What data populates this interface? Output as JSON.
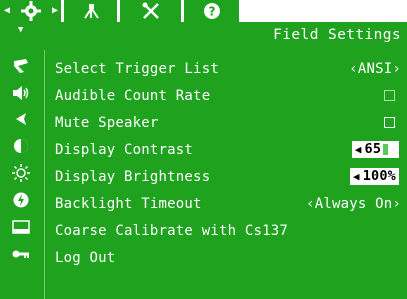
{
  "header": {
    "title": "Field Settings"
  },
  "tabs": [
    {
      "icon": "gear-icon"
    },
    {
      "icon": "tripod-icon"
    },
    {
      "icon": "tools-icon"
    },
    {
      "icon": "help-icon"
    }
  ],
  "menu": {
    "items": [
      {
        "label": "Select Trigger List",
        "value": "‹ANSI›",
        "icon": "flag-icon"
      },
      {
        "label": "Audible Count Rate",
        "icon": "speaker-icon"
      },
      {
        "label": "Mute Speaker",
        "icon": "mute-icon"
      },
      {
        "label": "Display Contrast",
        "value": "65",
        "icon": "contrast-icon"
      },
      {
        "label": "Display Brightness",
        "value": "100%",
        "icon": "brightness-icon"
      },
      {
        "label": "Backlight Timeout",
        "value": "‹Always On›",
        "icon": "backlight-icon"
      },
      {
        "label": "Coarse Calibrate with Cs137",
        "icon": "calibrate-icon"
      },
      {
        "label": "Log Out",
        "icon": "key-icon"
      }
    ]
  },
  "colors": {
    "background": "#1fa31f",
    "text": "#ffffff",
    "checkbox_inactive": "#a6e0a6"
  }
}
